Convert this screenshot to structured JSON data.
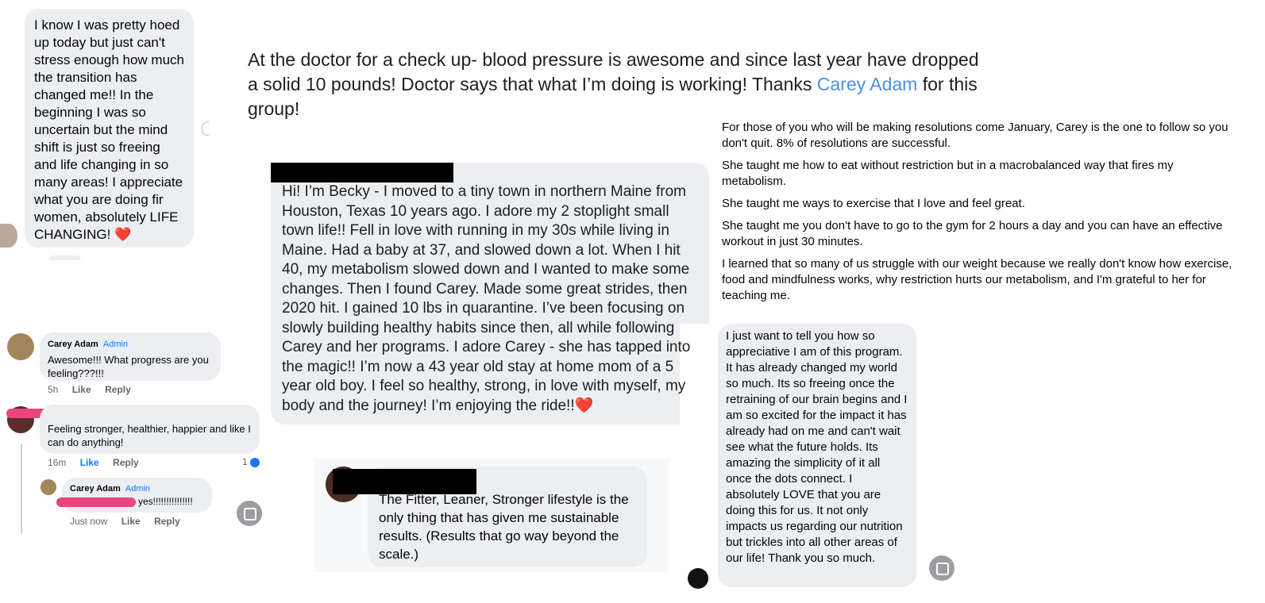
{
  "panel1": {
    "message": "I know I was pretty hoed up today but just can't stress enough how much the transition has changed me!! In the beginning I was so uncertain but the mind shift is just so freeing and life changing in so many areas! I appreciate what you are doing fir women, absolutely LIFE CHANGING! ❤️"
  },
  "doctor_post": {
    "text_before": "At the doctor for a check up- blood pressure is awesome and since last year have dropped a solid 10 pounds! Doctor says that what I’m doing is working! Thanks ",
    "mention": "Carey Adam",
    "text_after": " for this group!"
  },
  "becky_post": {
    "text": "Hi! I’m Becky - I moved to a tiny town in northern Maine from Houston, Texas 10 years ago. I adore my 2 stoplight small town life!! Fell in love with running in my 30s while living in Maine. Had a baby at 37, and slowed down a lot. When I hit 40, my metabolism slowed down and I wanted to make some changes. Then I found Carey. Made some great strides, then 2020 hit. I gained 10 lbs in quarantine. I’ve been focusing on slowly building healthy habits since then, all while following Carey and her programs. I adore Carey - she has tapped into the magic!! I’m now a 43 year old stay at home mom of a 5 year old boy. I feel so healthy, strong, in love with myself, my body and the journey! I’m enjoying the ride!!❤️"
  },
  "resolutions": {
    "paragraphs": [
      "For those of you who will be making resolutions come January, Carey is the one to follow so you don't quit. 8% of resolutions are successful.",
      "She taught me how to eat without restriction but in a macrobalanced way that fires my metabolism.",
      "She taught me ways to exercise that I love and feel great.",
      "She taught me you don't have to go to the gym for 2 hours a day and you can have an effective workout in just 30 minutes.",
      "I learned that so many of us struggle with our weight because we really don't know how exercise, food and mindfulness works, why restriction hurts our metabolism, and I'm grateful to her for teaching me."
    ]
  },
  "comments": {
    "carey1": {
      "name": "Carey Adam",
      "badge": "Admin",
      "text": "Awesome!!! What progress are you feeling???!!!",
      "time": "5h",
      "like": "Like",
      "reply": "Reply"
    },
    "user": {
      "text": "Feeling stronger, healthier, happier and like I can do anything!",
      "time": "16m",
      "like": "Like",
      "reply": "Reply",
      "reactions": "1"
    },
    "carey2": {
      "name": "Carey Adam",
      "badge": "Admin",
      "text": "yes!!!!!!!!!!!!!!!",
      "time": "Just now",
      "like": "Like",
      "reply": "Reply"
    }
  },
  "fitter_post": {
    "text": "The Fitter, Leaner, Stronger lifestyle is the only thing that has given me sustainable results. (Results that go way beyond the scale.)"
  },
  "appreciative_post": {
    "text": "I just want to tell you how so appreciative I am of this program. It has already changed my world so much. Its so freeing once the retraining of our brain begins and I am so excited for the impact it has already had on me and can't  wait see what the future holds. Its amazing the simplicity of it all once the dots connect. I absolutely LOVE that you are doing this for us. It not only impacts us regarding our nutrition but trickles into all other areas  of our life! Thank you so much."
  },
  "icons": [
    "avatar",
    "scan-text-icon",
    "like-reaction-icon",
    "heart-emoji"
  ],
  "colors": {
    "bubble": "#eceef1",
    "link": "#4a90e2",
    "admin": "#1877f2",
    "redaction": "#000000",
    "scribble": "#e8467c"
  }
}
